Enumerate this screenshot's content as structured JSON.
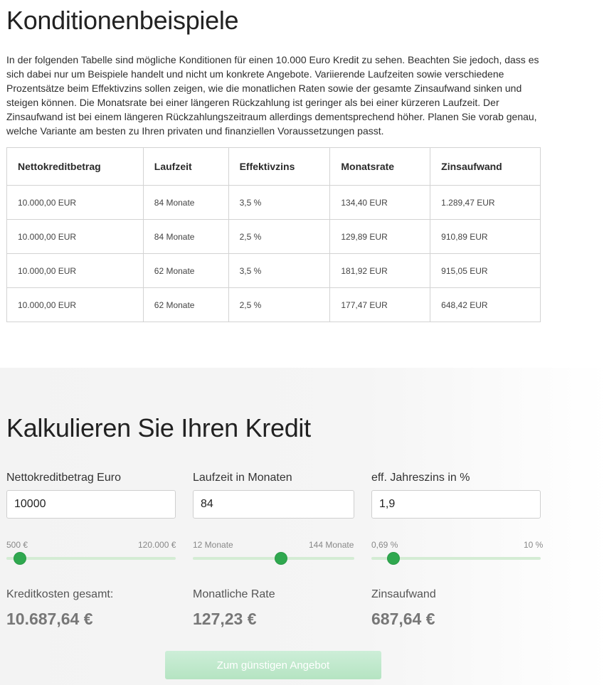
{
  "conditions": {
    "title": "Konditionenbeispiele",
    "intro": "In der folgenden Tabelle sind mögliche Konditionen für einen 10.000 Euro Kredit zu sehen. Beachten Sie jedoch, dass es sich dabei nur um Beispiele handelt und nicht um konkrete Angebote. Variierende Laufzeiten sowie verschiedene Prozentsätze beim Effektivzins sollen zeigen, wie die monatlichen Raten sowie der gesamte Zinsaufwand sinken und steigen können. Die Monatsrate bei einer längeren Rückzahlung ist geringer als bei einer kürzeren Laufzeit. Der Zinsaufwand ist bei einem längeren Rückzahlungszeitraum allerdings dementsprechend höher. Planen Sie vorab genau, welche Variante am besten zu Ihren privaten und finanziellen Voraussetzungen passt.",
    "headers": [
      "Nettokreditbetrag",
      "Laufzeit",
      "Effektivzins",
      "Monatsrate",
      "Zinsaufwand"
    ],
    "rows": [
      [
        "10.000,00 EUR",
        "84 Monate",
        "3,5 %",
        "134,40 EUR",
        "1.289,47 EUR"
      ],
      [
        "10.000,00 EUR",
        "84 Monate",
        "2,5 %",
        "129,89 EUR",
        "910,89 EUR"
      ],
      [
        "10.000,00 EUR",
        "62 Monate",
        "3,5 %",
        "181,92 EUR",
        "915,05 EUR"
      ],
      [
        "10.000,00 EUR",
        "62 Monate",
        "2,5 %",
        "177,47 EUR",
        "648,42 EUR"
      ]
    ]
  },
  "calculator": {
    "title": "Kalkulieren Sie Ihren Kredit",
    "amount": {
      "label": "Nettokreditbetrag Euro",
      "value": "10000",
      "min_label": "500 €",
      "max_label": "120.000 €",
      "slider_fraction": 0.081
    },
    "term": {
      "label": "Laufzeit in Monaten",
      "value": "84",
      "min_label": "12 Monate",
      "max_label": "144 Monate",
      "slider_fraction": 0.545
    },
    "rate": {
      "label": "eff. Jahreszins in %",
      "value": "1,9",
      "min_label": "0,69 %",
      "max_label": "10 %",
      "slider_fraction": 0.13
    },
    "results": {
      "total_label": "Kreditkosten gesamt:",
      "total_value": "10.687,64 €",
      "monthly_label": "Monatliche Rate",
      "monthly_value": "127,23 €",
      "interest_label": "Zinsaufwand",
      "interest_value": "687,64 €"
    },
    "cta_label": "Zum günstigen Angebot"
  },
  "colors": {
    "accent": "#2fa84f",
    "track": "#d4ecd4",
    "cta": "#b5e4c2"
  }
}
